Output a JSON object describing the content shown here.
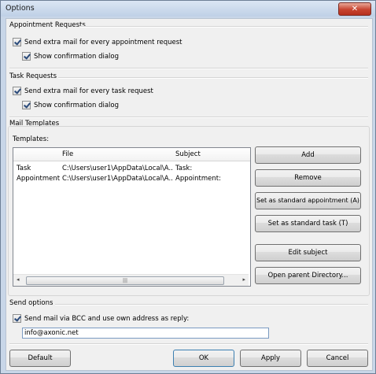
{
  "window": {
    "title": "Options",
    "close_glyph": "✕"
  },
  "appointment_requests": {
    "title": "Appointment Requests",
    "send_extra_mail": "Send extra mail for every appointment request",
    "show_confirmation": "Show confirmation dialog"
  },
  "task_requests": {
    "title": "Task Requests",
    "send_extra_mail": "Send extra mail for every task request",
    "show_confirmation": "Show confirmation dialog"
  },
  "mail_templates": {
    "title": "Mail Templates",
    "templates_label": "Templates:",
    "columns": [
      "",
      "File",
      "Subject"
    ],
    "rows": [
      [
        "Task",
        "C:\\Users\\user1\\AppData\\Local\\A...",
        "Task:"
      ],
      [
        "Appointment",
        "C:\\Users\\user1\\AppData\\Local\\A...",
        "Appointment:"
      ]
    ],
    "scroll_left": "◂",
    "scroll_right": "▸",
    "scroll_grip": "|||",
    "buttons": {
      "add": "Add",
      "remove": "Remove",
      "std_appointment": "Set as standard appointment (A)",
      "std_task": "Set as standard task (T)",
      "edit_subject": "Edit subject",
      "open_parent": "Open parent Directory..."
    }
  },
  "send_options": {
    "title": "Send options",
    "bcc_label": "Send mail via BCC and use own address as reply:",
    "email_value": "info@axonic.net"
  },
  "footer": {
    "default": "Default",
    "ok": "OK",
    "apply": "Apply",
    "cancel": "Cancel"
  }
}
